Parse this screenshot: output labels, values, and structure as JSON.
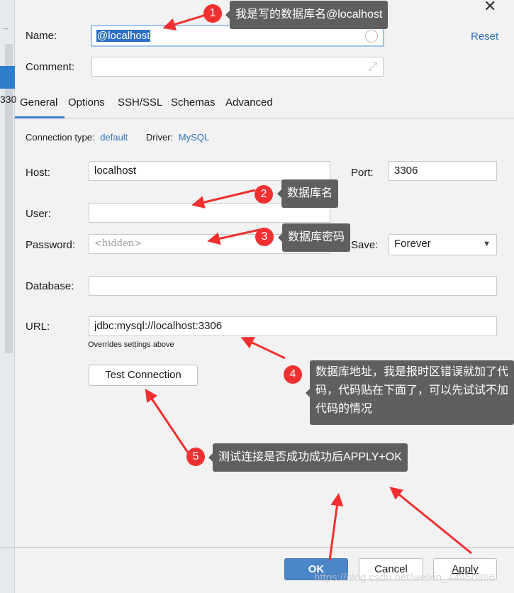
{
  "sidebar": {
    "partial_text": "330"
  },
  "form": {
    "name_label": "Name:",
    "name_value": "@localhost",
    "reset_label": "Reset",
    "comment_label": "Comment:",
    "tabs": [
      {
        "label": "General"
      },
      {
        "label": "Options"
      },
      {
        "label": "SSH/SSL"
      },
      {
        "label": "Schemas"
      },
      {
        "label": "Advanced"
      }
    ],
    "connection_type_label": "Connection type:",
    "connection_type_value": "default",
    "driver_label": "Driver:",
    "driver_value": "MySQL",
    "host_label": "Host:",
    "host_value": "localhost",
    "port_label": "Port:",
    "port_value": "3306",
    "user_label": "User:",
    "user_value": "",
    "password_label": "Password:",
    "password_placeholder": "<hidden>",
    "save_label": "Save:",
    "save_value": "Forever",
    "database_label": "Database:",
    "database_value": "",
    "url_label": "URL:",
    "url_value": "jdbc:mysql://localhost:3306",
    "url_hint": "Overrides settings above",
    "test_connection_label": "Test Connection"
  },
  "footer": {
    "ok_label": "OK",
    "cancel_label": "Cancel",
    "apply_label": "Apply"
  },
  "annotations": [
    {
      "num": "1",
      "text": "我是写的数据库名@localhost"
    },
    {
      "num": "2",
      "text": "数据库名"
    },
    {
      "num": "3",
      "text": "数据库密码"
    },
    {
      "num": "4",
      "text": "数据库地址，我是报时区错误就加了代码，代码贴在下面了，可以先试试不加代码的情况"
    },
    {
      "num": "5",
      "text": "测试连接是否成功成功后APPLY+OK"
    }
  ],
  "watermark": "https://blog.csdn.net/weixin_44460896",
  "colors": {
    "accent": "#2f72b8",
    "annotation_red": "#f03030",
    "callout_bg": "#5f5f5f",
    "ok_button": "#4a86c8"
  }
}
